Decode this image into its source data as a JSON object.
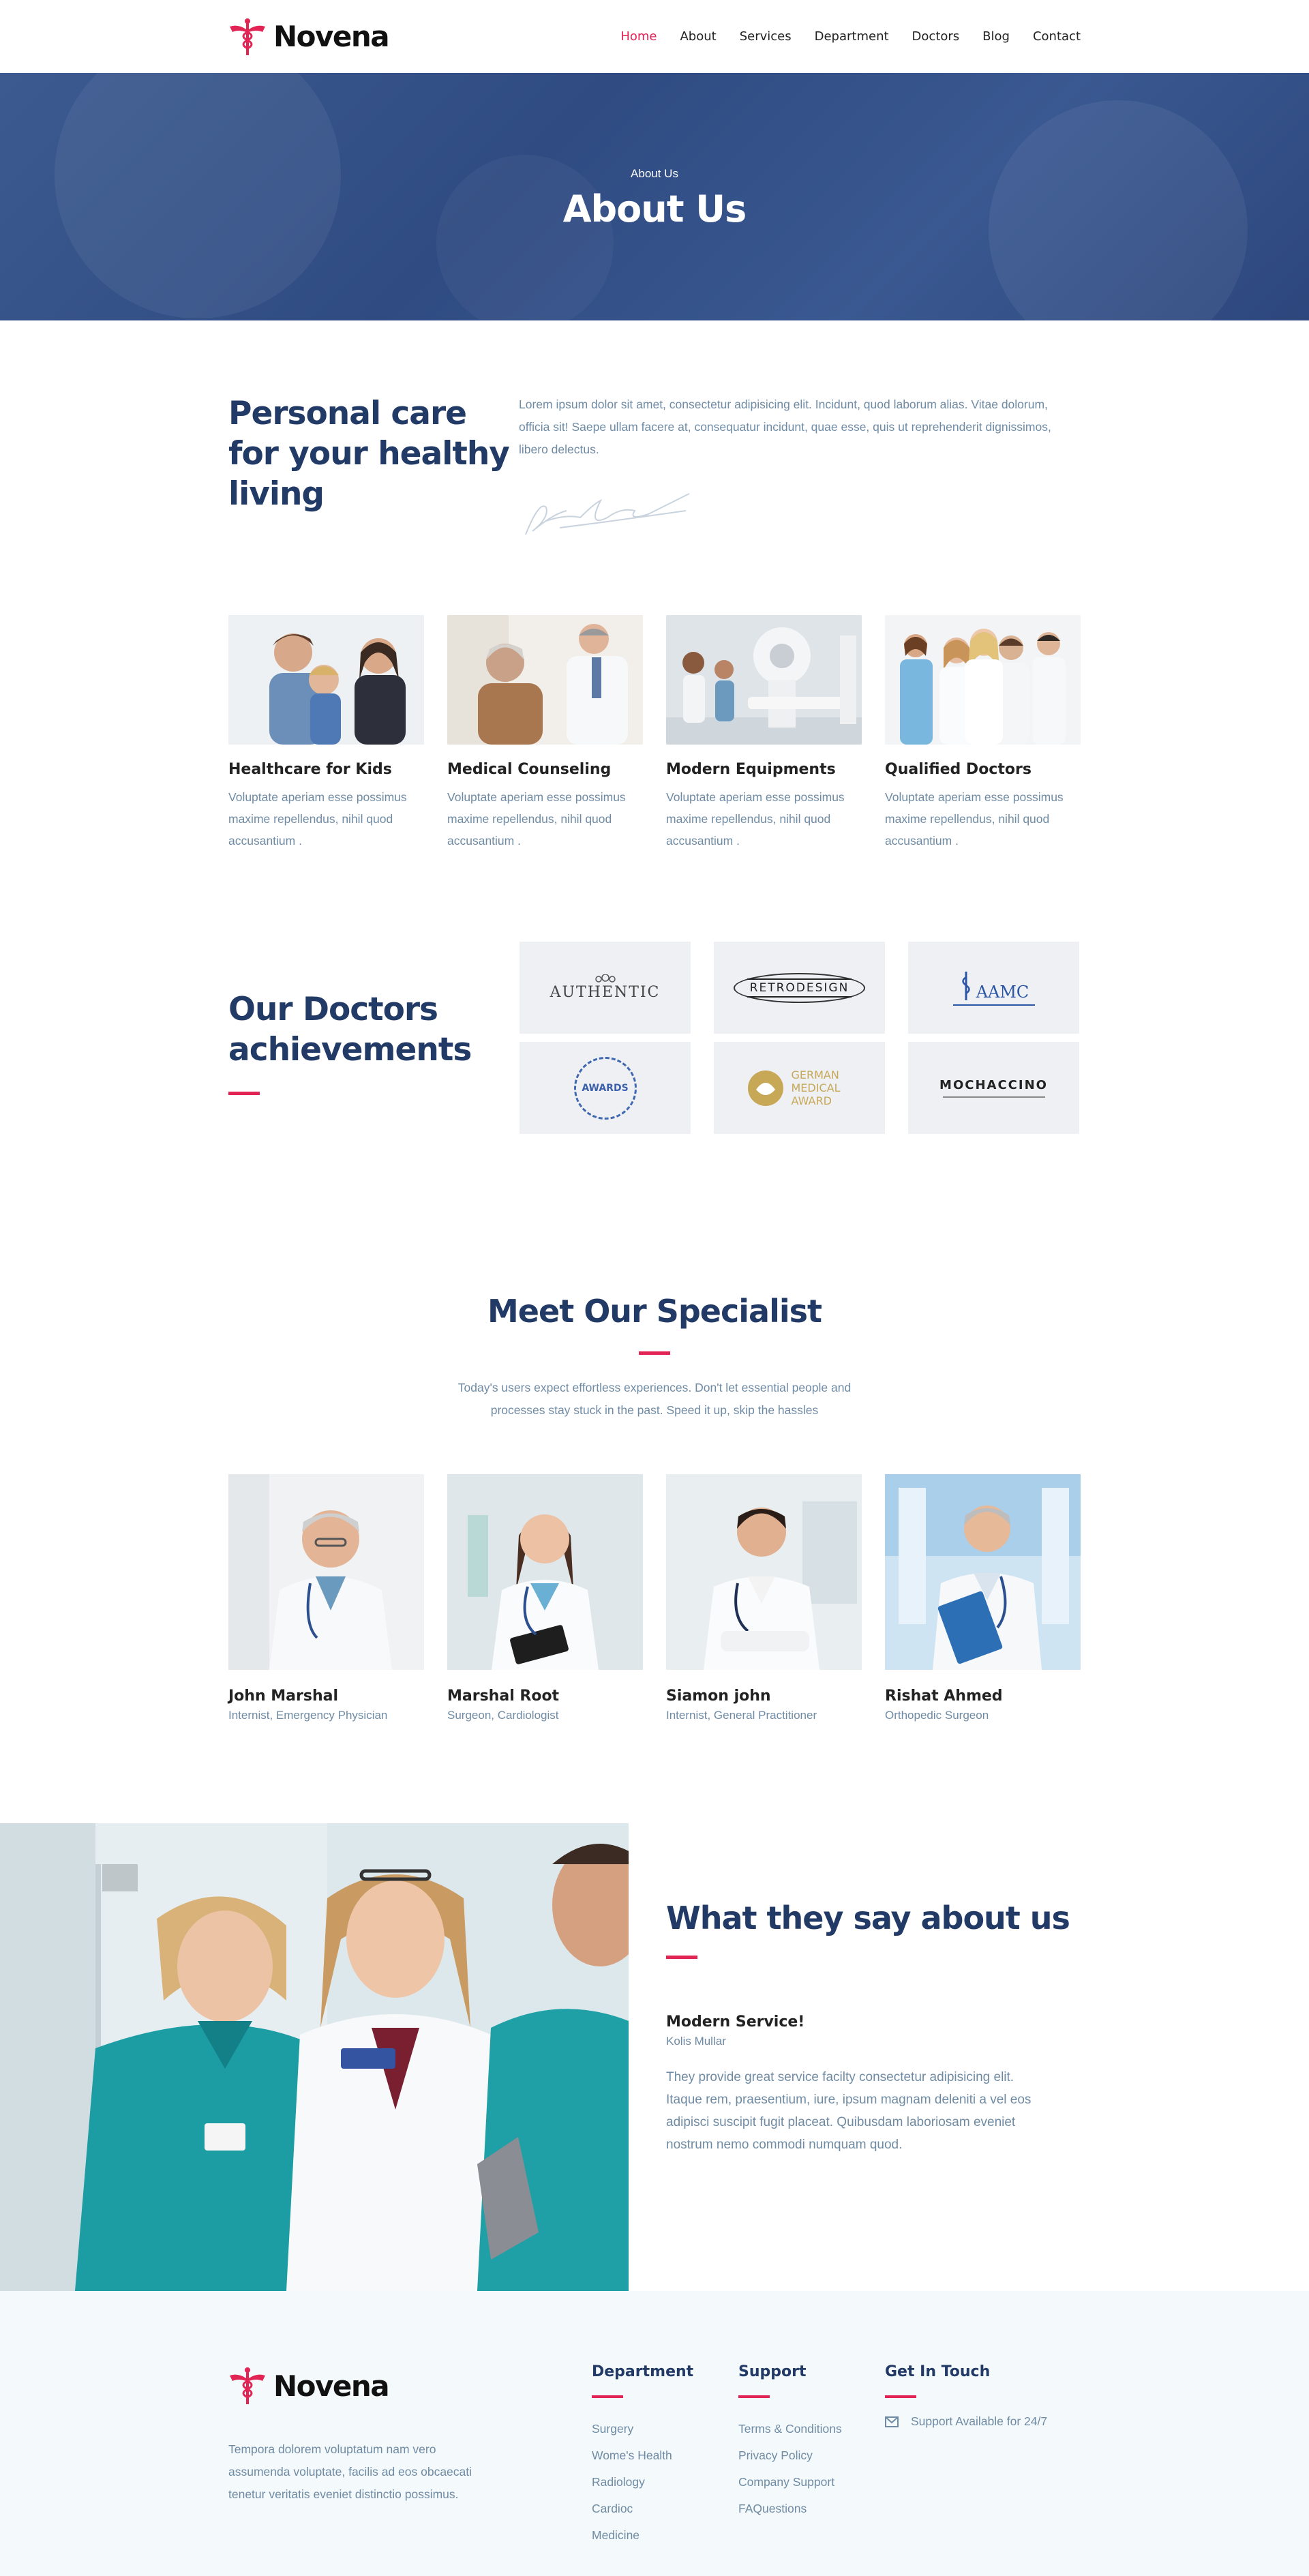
{
  "brand": {
    "name": "Novena"
  },
  "nav": {
    "items": [
      "Home",
      "About",
      "Services",
      "Department",
      "Doctors",
      "Blog",
      "Contact"
    ],
    "active": "Home"
  },
  "hero": {
    "subtitle": "About Us",
    "title": "About Us"
  },
  "intro": {
    "title": "Personal care for your healthy living",
    "text": "Lorem ipsum dolor sit amet, consectetur adipisicing elit. Incidunt, quod laborum alias. Vitae dolorum, officia sit! Saepe ullam facere at, consequatur incidunt, quae esse, quis ut reprehenderit dignissimos, libero delectus."
  },
  "features": [
    {
      "title": "Healthcare for Kids",
      "text": "Voluptate aperiam esse possimus maxime repellendus, nihil quod accusantium ."
    },
    {
      "title": "Medical Counseling",
      "text": "Voluptate aperiam esse possimus maxime repellendus, nihil quod accusantium ."
    },
    {
      "title": "Modern Equipments",
      "text": "Voluptate aperiam esse possimus maxime repellendus, nihil quod accusantium ."
    },
    {
      "title": "Qualified Doctors",
      "text": "Voluptate aperiam esse possimus maxime repellendus, nihil quod accusantium ."
    }
  ],
  "achievements": {
    "title": "Our Doctors achievements",
    "logos": [
      "AUTHENTIC",
      "RETRODESIGN",
      "AAMC",
      "AWARDS",
      "GERMAN MEDICAL AWARD",
      "MOCHACCINO"
    ]
  },
  "specialists": {
    "title": "Meet Our Specialist",
    "description": "Today's users expect effortless experiences. Don't let essential people and processes stay stuck in the past. Speed it up, skip the hassles",
    "members": [
      {
        "name": "John Marshal",
        "role": "Internist, Emergency Physician"
      },
      {
        "name": "Marshal Root",
        "role": "Surgeon, Cardiologist"
      },
      {
        "name": "Siamon john",
        "role": "Internist, General Practitioner"
      },
      {
        "name": "Rishat Ahmed",
        "role": "Orthopedic Surgeon"
      }
    ]
  },
  "testimonial": {
    "title": "What they say about us",
    "quote_title": "Modern Service!",
    "author": "Kolis Mullar",
    "text": "They provide great service facilty consectetur adipisicing elit. Itaque rem, praesentium, iure, ipsum magnam deleniti a vel eos adipisci suscipit fugit placeat. Quibusdam laboriosam eveniet nostrum nemo commodi numquam quod."
  },
  "footer": {
    "description": "Tempora dolorem voluptatum nam vero assumenda voluptate, facilis ad eos obcaecati tenetur veritatis eveniet distinctio possimus.",
    "department": {
      "title": "Department",
      "items": [
        "Surgery",
        "Wome's Health",
        "Radiology",
        "Cardioc",
        "Medicine"
      ]
    },
    "support": {
      "title": "Support",
      "items": [
        "Terms & Conditions",
        "Privacy Policy",
        "Company Support",
        "FAQuestions"
      ]
    },
    "contact": {
      "title": "Get In Touch",
      "text": "Support Available for 24/7"
    }
  },
  "colors": {
    "primary": "#223a66",
    "accent": "#e12454",
    "text": "#6f8ba4",
    "footer_bg": "#f4f9fc"
  }
}
